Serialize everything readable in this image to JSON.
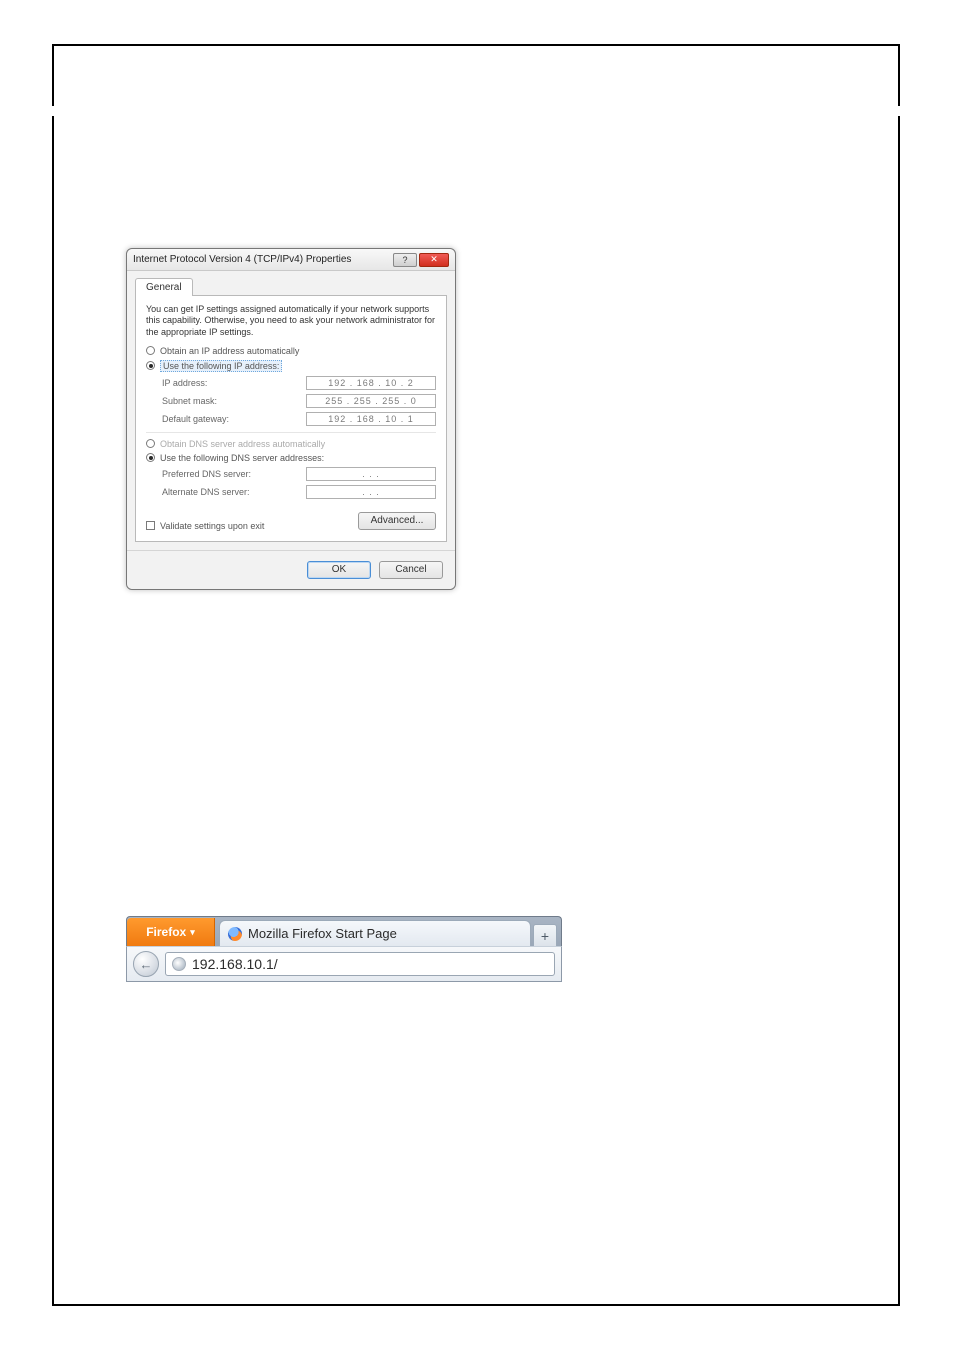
{
  "ipv4": {
    "title": "Internet Protocol Version 4 (TCP/IPv4) Properties",
    "tab_general": "General",
    "intro": "You can get IP settings assigned automatically if your network supports this capability. Otherwise, you need to ask your network administrator for the appropriate IP settings.",
    "radio_auto_ip": "Obtain an IP address automatically",
    "radio_use_ip": "Use the following IP address:",
    "ip_label": "IP address:",
    "ip_value": "192 . 168 . 10 . 2",
    "subnet_label": "Subnet mask:",
    "subnet_value": "255 . 255 . 255 . 0",
    "gateway_label": "Default gateway:",
    "gateway_value": "192 . 168 . 10 . 1",
    "radio_auto_dns": "Obtain DNS server address automatically",
    "radio_use_dns": "Use the following DNS server addresses:",
    "pref_dns_label": "Preferred DNS server:",
    "pref_dns_value": ".       .       .",
    "alt_dns_label": "Alternate DNS server:",
    "alt_dns_value": ".       .       .",
    "validate_label": "Validate settings upon exit",
    "advanced_btn": "Advanced...",
    "ok": "OK",
    "cancel": "Cancel",
    "help_glyph": "?",
    "close_glyph": "✕"
  },
  "firefox": {
    "app_button": "Firefox",
    "tab_title": "Mozilla Firefox Start Page",
    "newtab": "+",
    "back": "←",
    "url": "192.168.10.1/"
  }
}
